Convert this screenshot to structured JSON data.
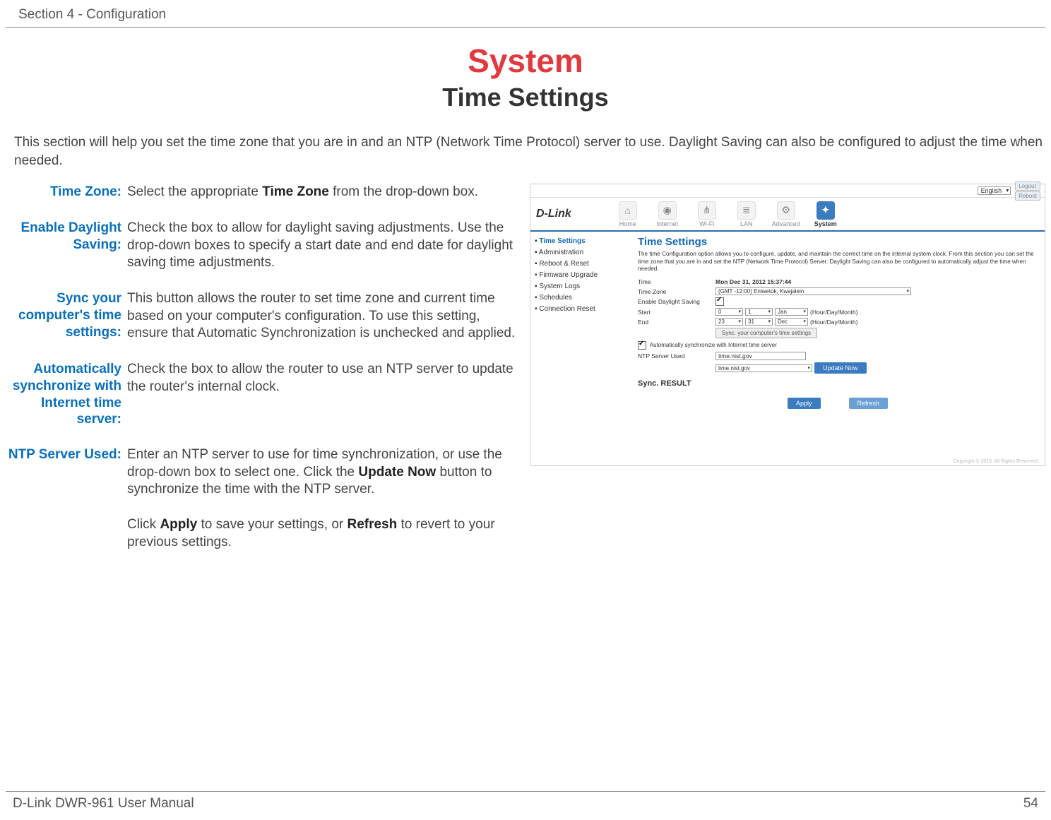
{
  "header": {
    "section": "Section 4 - Configuration"
  },
  "title": "System",
  "subtitle": "Time Settings",
  "intro": "This section will help you set the time zone that you are in and an NTP (Network Time Protocol) server to use. Daylight Saving can also be configured to adjust the time when needed.",
  "defs": [
    {
      "label": "Time Zone:",
      "body": "Select the appropriate <b>Time Zone</b> from the drop-down box."
    },
    {
      "label": "Enable Daylight Saving:",
      "body": "Check the box to allow for daylight saving adjustments. Use the drop-down boxes to specify a start date and end date for daylight saving time adjustments."
    },
    {
      "label": "Sync your computer's time settings:",
      "body": "This button allows the router to set time zone and current time based on your computer's configuration. To use this setting, ensure that Automatic Synchronization is unchecked and applied."
    },
    {
      "label": "Automatically synchronize with Internet time server:",
      "body": "Check the box to allow the router to use an NTP server to update the router's internal clock."
    },
    {
      "label": "NTP Server Used:",
      "body": "Enter an NTP server to use for time synchronization, or use the drop-down box to select one. Click the <b>Update Now</b> button to synchronize the time with the NTP server.<br><br>Click <b>Apply</b> to save your settings, or <b>Refresh</b> to revert to your previous settings."
    }
  ],
  "screenshot": {
    "lang": "English",
    "logout": "Logout",
    "reboot": "Reboot",
    "logo": "D-Link",
    "tabs": [
      {
        "label": "Home",
        "icon": "⌂"
      },
      {
        "label": "Internet",
        "icon": "◉"
      },
      {
        "label": "Wi-Fi",
        "icon": "⋔"
      },
      {
        "label": "LAN",
        "icon": "≣"
      },
      {
        "label": "Advanced",
        "icon": "⚙"
      },
      {
        "label": "System",
        "icon": "✦",
        "active": true
      }
    ],
    "side": [
      {
        "label": "Time Settings",
        "active": true
      },
      {
        "label": "Administration"
      },
      {
        "label": "Reboot & Reset"
      },
      {
        "label": "Firmware Upgrade"
      },
      {
        "label": "System Logs"
      },
      {
        "label": "Schedules"
      },
      {
        "label": "Connection Reset"
      }
    ],
    "heading": "Time Settings",
    "desc": "The time Configuration option allows you to configure, update, and maintain the correct time on the internal system clock. From this section you can set the time zone that you are in and set the NTP (Network Time Protocol) Server. Daylight Saving can also be configured to automatically adjust the time when needed.",
    "form": {
      "time_label": "Time",
      "time_value": "Mon Dec 31, 2012 15:37:44",
      "tz_label": "Time Zone",
      "tz_value": "(GMT -12:00) Eniwetok, Kwajalein",
      "dst_label": "Enable Daylight Saving",
      "start_label": "Start",
      "start_hour": "0",
      "start_day": "1",
      "start_month": "Jan",
      "end_label": "End",
      "end_hour": "23",
      "end_day": "31",
      "end_month": "Dec",
      "hdm": "(Hour/Day/Month)",
      "sync_btn": "Sync. your computer's time settings",
      "auto_label": "Automatically synchronize with Internet time server",
      "ntp_label": "NTP Server Used",
      "ntp_value": "time.nist.gov",
      "ntp_select": "time.nist.gov",
      "update_btn": "Update Now",
      "result": "Sync. RESULT",
      "apply": "Apply",
      "refresh": "Refresh",
      "copyright": "Copyright © 2013. All Rights Reserved."
    }
  },
  "footer": {
    "left": "D-Link DWR-961 User Manual",
    "right": "54"
  }
}
